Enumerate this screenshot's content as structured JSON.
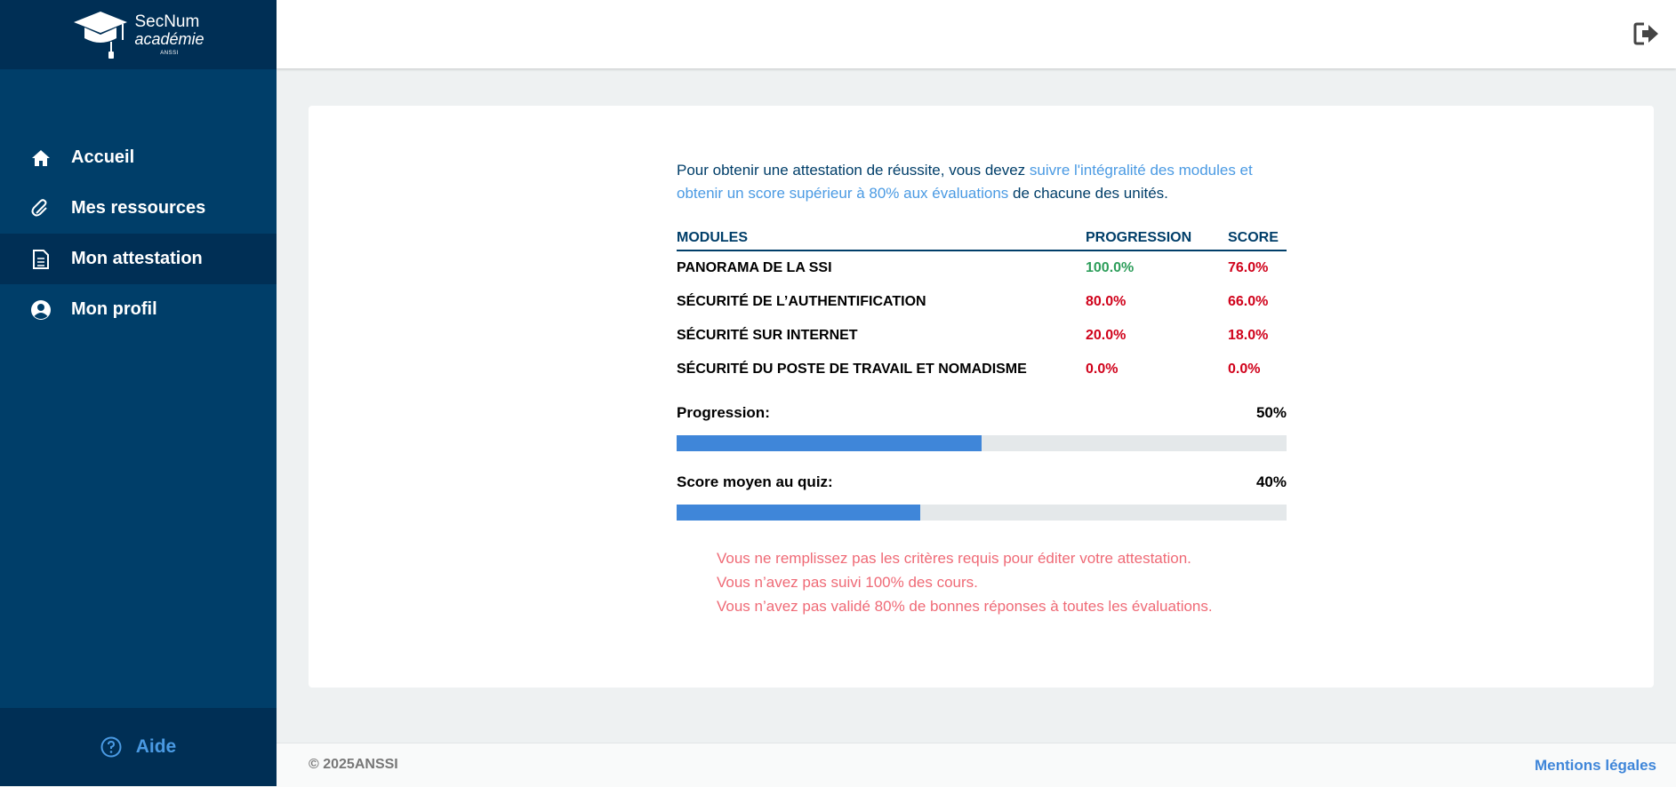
{
  "brand": {
    "name": "SecNum",
    "sub": "académie",
    "tiny": "ANSSI"
  },
  "sidebar": {
    "items": [
      {
        "label": "Accueil",
        "icon": "home-icon"
      },
      {
        "label": "Mes ressources",
        "icon": "paperclip-icon"
      },
      {
        "label": "Mon attestation",
        "icon": "document-icon",
        "active": true
      },
      {
        "label": "Mon profil",
        "icon": "user-circle-icon"
      }
    ],
    "help_label": "Aide"
  },
  "main": {
    "intro": {
      "part1": "Pour obtenir une attestation de réussite, vous devez ",
      "highlight": "suivre l'intégralité des modules et obtenir un score supérieur à 80% aux évaluations",
      "part2": " de chacune des unités."
    },
    "table": {
      "headers": {
        "modules": "MODULES",
        "progression": "PROGRESSION",
        "score": "SCORE"
      },
      "rows": [
        {
          "module": "PANORAMA DE LA SSI",
          "progression": "100.0%",
          "score": "76.0%"
        },
        {
          "module": "SÉCURITÉ DE L’AUTHENTIFICATION",
          "progression": "80.0%",
          "score": "66.0%"
        },
        {
          "module": "SÉCURITÉ SUR INTERNET",
          "progression": "20.0%",
          "score": "18.0%"
        },
        {
          "module": "SÉCURITÉ DU POSTE DE TRAVAIL ET NOMADISME",
          "progression": "0.0%",
          "score": "0.0%"
        }
      ]
    },
    "progression": {
      "label": "Progression:",
      "value_text": "50%",
      "value": 50
    },
    "quiz": {
      "label": "Score moyen au quiz:",
      "value_text": "40%",
      "value": 40
    },
    "warnings": [
      "Vous ne remplissez pas les critères requis pour éditer votre attestation.",
      "Vous n’avez pas suivi 100% des cours.",
      "Vous n’avez pas validé 80% de bonnes réponses à toutes les évaluations."
    ]
  },
  "footer": {
    "copyright": "© 2025ANSSI",
    "legal": "Mentions légales"
  },
  "colors": {
    "sidebar": "#003e69",
    "accent": "#4a9ae3",
    "bar": "#3f86d9",
    "success": "#2e9e5b",
    "danger": "#d0021b",
    "warning": "#ef6a76"
  }
}
